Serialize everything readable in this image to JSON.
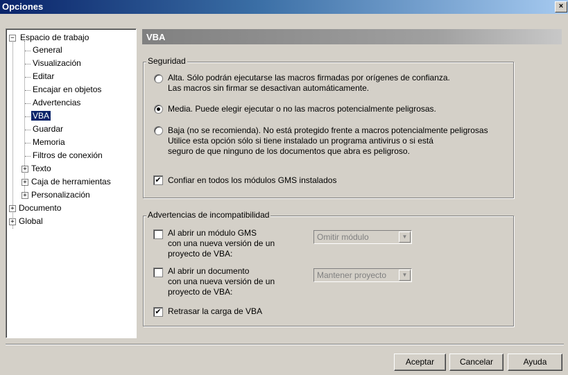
{
  "window": {
    "title": "Opciones",
    "close_glyph": "×"
  },
  "tree": {
    "root": {
      "label": "Espacio de trabajo",
      "expander": "−"
    },
    "children": [
      "General",
      "Visualización",
      "Editar",
      "Encajar en objetos",
      "Advertencias",
      "VBA",
      "Guardar",
      "Memoria",
      "Filtros de conexión"
    ],
    "expandable_children": [
      "Texto",
      "Caja de herramientas",
      "Personalización"
    ],
    "top_level": [
      "Documento",
      "Global"
    ],
    "expander_plus": "+",
    "selected": "VBA"
  },
  "panel": {
    "header": "VBA",
    "security": {
      "legend": "Seguridad",
      "options": [
        {
          "line1": "Alta. Sólo podrán ejecutarse las macros firmadas por orígenes de confianza.",
          "line2": "Las macros sin firmar se desactivan automáticamente."
        },
        {
          "line1": "Media. Puede elegir ejecutar o no las macros potencialmente peligrosas."
        },
        {
          "line1": "Baja (no se recomienda). No está protegido frente a macros potencialmente peligrosas",
          "line2": "Utilice esta opción sólo si tiene instalado un programa antivirus o si está",
          "line3": "seguro de que ninguno de los documentos que abra es peligroso."
        }
      ],
      "selected_option": 1,
      "trust_label": "Confiar en todos los módulos GMS instalados",
      "trust_checked": true
    },
    "incompat": {
      "legend": "Advertencias de incompatibilidad",
      "gms": {
        "line1": "Al abrir un módulo GMS",
        "line2": "con una nueva versión de un",
        "line3": "proyecto de VBA:",
        "checked": false,
        "combo": "Omitir módulo"
      },
      "doc": {
        "line1": "Al abrir un documento",
        "line2": "con una nueva versión de un",
        "line3": "proyecto de VBA:",
        "checked": false,
        "combo": "Mantener proyecto"
      },
      "delay": {
        "label": "Retrasar la carga de VBA",
        "checked": true
      },
      "check_glyph": "✔",
      "arrow_glyph": "▼"
    }
  },
  "buttons": {
    "ok": "Aceptar",
    "cancel": "Cancelar",
    "help": "Ayuda"
  }
}
